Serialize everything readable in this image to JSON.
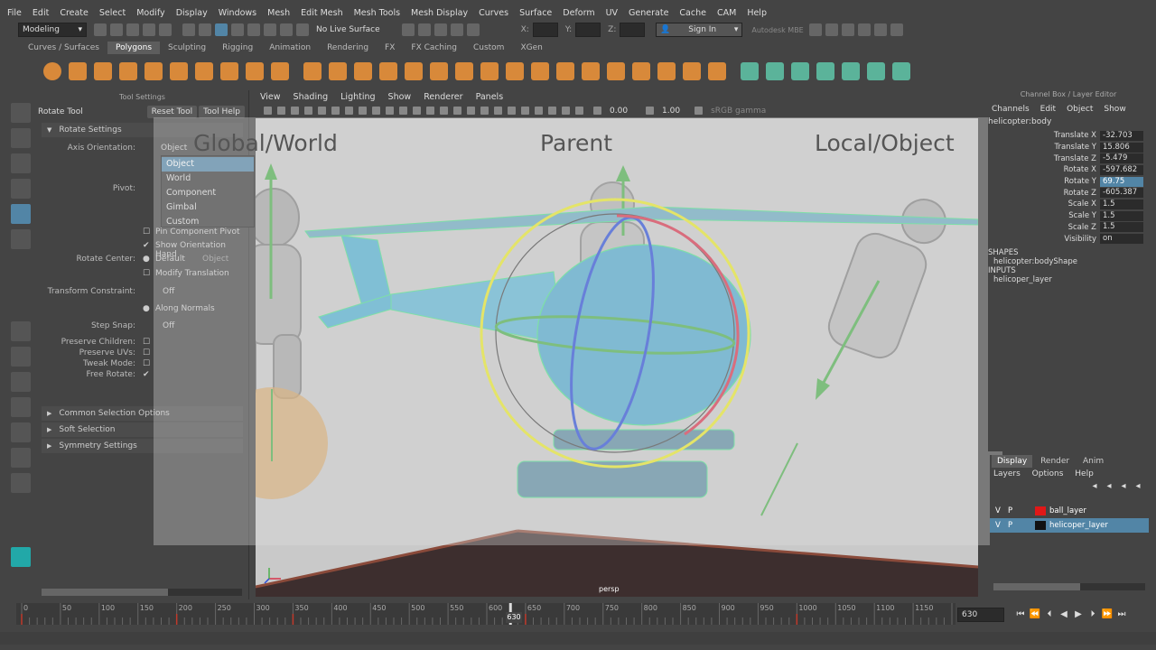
{
  "menubar": [
    "File",
    "Edit",
    "Create",
    "Select",
    "Modify",
    "Display",
    "Windows",
    "Mesh",
    "Edit Mesh",
    "Mesh Tools",
    "Mesh Display",
    "Curves",
    "Surface",
    "Deform",
    "UV",
    "Generate",
    "Cache",
    "CAM",
    "Help"
  ],
  "status": {
    "workspace": "Modeling",
    "live_surface": "No Live Surface",
    "x_label": "X:",
    "y_label": "Y:",
    "z_label": "Z:",
    "sign_in": "Sign In",
    "brand": "Autodesk MBE"
  },
  "shelf_tabs": [
    "Curves / Surfaces",
    "Polygons",
    "Sculpting",
    "Rigging",
    "Animation",
    "Rendering",
    "FX",
    "FX Caching",
    "Custom",
    "XGen"
  ],
  "tool_settings": {
    "header": "Tool Settings",
    "tool_name": "Rotate Tool",
    "reset_label": "Reset Tool",
    "help_label": "Tool Help",
    "section_rotate": "Rotate Settings",
    "axis_label": "Axis Orientation:",
    "axis_value": "Object",
    "pivot_label": "Pivot:",
    "pin_pivot": "Pin Component Pivot",
    "show_orientation": "Show Orientation Hand",
    "rotate_center_label": "Rotate Center:",
    "rotate_center_default": "Default",
    "rotate_center_object": "Object",
    "modify_translation": "Modify Translation",
    "transform_constraint_label": "Transform Constraint:",
    "transform_constraint_value": "Off",
    "along_normals": "Along Normals",
    "step_snap_label": "Step Snap:",
    "step_snap_value": "Off",
    "preserve_children": "Preserve Children:",
    "preserve_uvs": "Preserve UVs:",
    "tweak_mode": "Tweak Mode:",
    "free_rotate": "Free Rotate:",
    "section_common": "Common Selection Options",
    "section_soft": "Soft Selection",
    "section_sym": "Symmetry Settings"
  },
  "dropdown_options": [
    "Object",
    "World",
    "Component",
    "Gimbal",
    "Custom"
  ],
  "panel_menu": [
    "View",
    "Shading",
    "Lighting",
    "Show",
    "Renderer",
    "Panels"
  ],
  "panel_toolbar": {
    "exposure": "0.00",
    "gamma": "1.00",
    "colorspace": "sRGB gamma"
  },
  "viewport": {
    "camera": "persp"
  },
  "overlay": {
    "left": "Global/World",
    "center": "Parent",
    "right": "Local/Object"
  },
  "channel_box": {
    "header": "Channel Box / Layer Editor",
    "menu": [
      "Channels",
      "Edit",
      "Object",
      "Show"
    ],
    "object": "helicopter:body",
    "attrs": [
      {
        "name": "Translate X",
        "value": "-32.703"
      },
      {
        "name": "Translate Y",
        "value": "15.806"
      },
      {
        "name": "Translate Z",
        "value": "-5.479"
      },
      {
        "name": "Rotate X",
        "value": "-597.682"
      },
      {
        "name": "Rotate Y",
        "value": "69.75"
      },
      {
        "name": "Rotate Z",
        "value": "-605.387"
      },
      {
        "name": "Scale X",
        "value": "1.5"
      },
      {
        "name": "Scale Y",
        "value": "1.5"
      },
      {
        "name": "Scale Z",
        "value": "1.5"
      },
      {
        "name": "Visibility",
        "value": "on"
      }
    ],
    "shapes_label": "SHAPES",
    "shape": "helicopter:bodyShape",
    "inputs_label": "INPUTS",
    "input": "helicoper_layer"
  },
  "layers": {
    "tabs": [
      "Display",
      "Render",
      "Anim"
    ],
    "menu": [
      "Layers",
      "Options",
      "Help"
    ],
    "rows": [
      {
        "v": "V",
        "p": "P",
        "color": "#e01818",
        "name": "ball_layer"
      },
      {
        "v": "V",
        "p": "P",
        "color": "#111111",
        "name": "helicoper_layer"
      }
    ]
  },
  "timeline": {
    "ticks": [
      "0",
      "50",
      "100",
      "150",
      "200",
      "250",
      "300",
      "350",
      "400",
      "450",
      "500",
      "550",
      "600",
      "650",
      "700",
      "750",
      "800",
      "850",
      "900",
      "950",
      "1000",
      "1050",
      "1100",
      "1150"
    ],
    "current": "630",
    "current_field": "630"
  }
}
